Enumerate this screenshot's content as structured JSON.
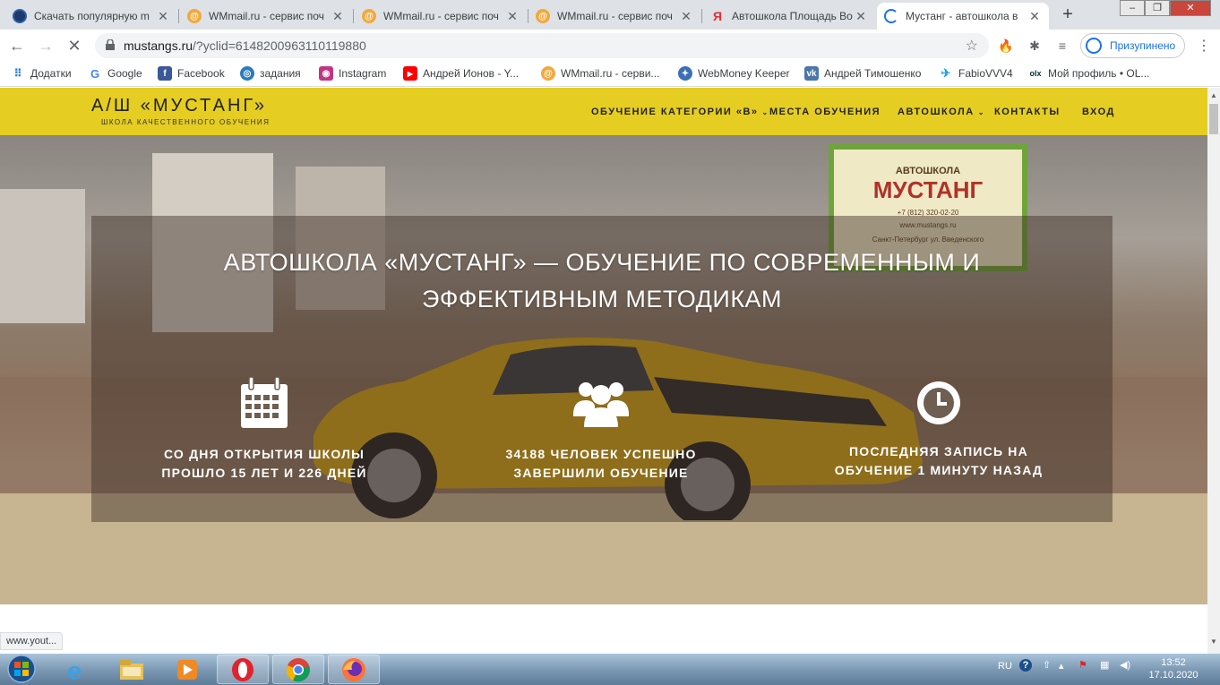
{
  "browser": {
    "tabs": [
      {
        "title": "Скачать популярную m",
        "favicon": "globe-icon"
      },
      {
        "title": "WMmail.ru - сервис поч",
        "favicon": "wmmail-icon"
      },
      {
        "title": "WMmail.ru - сервис поч",
        "favicon": "wmmail-icon"
      },
      {
        "title": "WMmail.ru - сервис поч",
        "favicon": "wmmail-icon"
      },
      {
        "title": "Автошкола Площадь Во",
        "favicon": "yandex-icon"
      },
      {
        "title": "Мустанг - автошкола в",
        "favicon": "loading-icon",
        "active": true
      }
    ],
    "url_host": "mustangs.ru",
    "url_path": "/?yclid=6148200963110119880",
    "profile_label": "Призупинено",
    "bookmarks": [
      {
        "label": "Додатки",
        "icon": "apps-grid-icon"
      },
      {
        "label": "Google",
        "icon": "google-icon"
      },
      {
        "label": "Facebook",
        "icon": "facebook-icon"
      },
      {
        "label": "задания",
        "icon": "zadaniya-icon"
      },
      {
        "label": "Instagram",
        "icon": "instagram-icon"
      },
      {
        "label": "Андрей Ионов - Y...",
        "icon": "youtube-icon"
      },
      {
        "label": "WMmail.ru - серви...",
        "icon": "wmmail-icon"
      },
      {
        "label": "WebMoney Keeper",
        "icon": "webmoney-icon"
      },
      {
        "label": "Андрей Тимошенко",
        "icon": "vk-icon"
      },
      {
        "label": "FabioVVV4",
        "icon": "twitter-icon"
      },
      {
        "label": "Мой профиль • OL...",
        "icon": "olx-icon"
      }
    ],
    "status_text": "www.yout..."
  },
  "site": {
    "logo_title": "А/Ш «МУСТАНГ»",
    "logo_subtitle": "ШКОЛА КАЧЕСТВЕННОГО ОБУЧЕНИЯ",
    "menu": [
      {
        "label": "ОБУЧЕНИЕ КАТЕГОРИИ «B»",
        "dropdown": true
      },
      {
        "label": "МЕСТА ОБУЧЕНИЯ",
        "dropdown": false
      },
      {
        "label": "АВТОШКОЛА",
        "dropdown": true
      },
      {
        "label": "КОНТАКТЫ",
        "dropdown": false
      },
      {
        "label": "ВХОД",
        "dropdown": false
      }
    ],
    "hero": {
      "title_line1": "АВТОШКОЛА «МУСТАНГ» — ОБУЧЕНИЕ ПО СОВРЕМЕННЫМ И",
      "title_line2": "ЭФФЕКТИВНЫМ МЕТОДИКАМ",
      "billboard": {
        "line1": "АВТОШКОЛА",
        "line2": "МУСТАНГ",
        "line3": "+7 (812) 320-02-20",
        "line4": "www.mustangs.ru",
        "line5": "Санкт-Петербург ул. Введенского"
      },
      "stats": [
        {
          "icon": "calendar-icon",
          "line1": "СО ДНЯ ОТКРЫТИЯ ШКОЛЫ",
          "line2": "ПРОШЛО 15 ЛЕТ И 226 ДНЕЙ"
        },
        {
          "icon": "users-icon",
          "line1": "34188 ЧЕЛОВЕК УСПЕШНО",
          "line2": "ЗАВЕРШИЛИ ОБУЧЕНИЕ"
        },
        {
          "icon": "clock-icon",
          "line1": "ПОСЛЕДНЯЯ ЗАПИСЬ НА",
          "line2": "ОБУЧЕНИЕ 1 МИНУТУ НАЗАД"
        }
      ]
    }
  },
  "taskbar": {
    "language": "RU",
    "time": "13:52",
    "date": "17.10.2020",
    "apps": [
      "ie-icon",
      "explorer-icon",
      "media-player-icon",
      "opera-icon",
      "chrome-icon",
      "firefox-icon"
    ]
  },
  "colors": {
    "brand_yellow": "#e5cd22",
    "chrome_tab_bg": "#dee1e6",
    "link_blue": "#1a73e8"
  }
}
